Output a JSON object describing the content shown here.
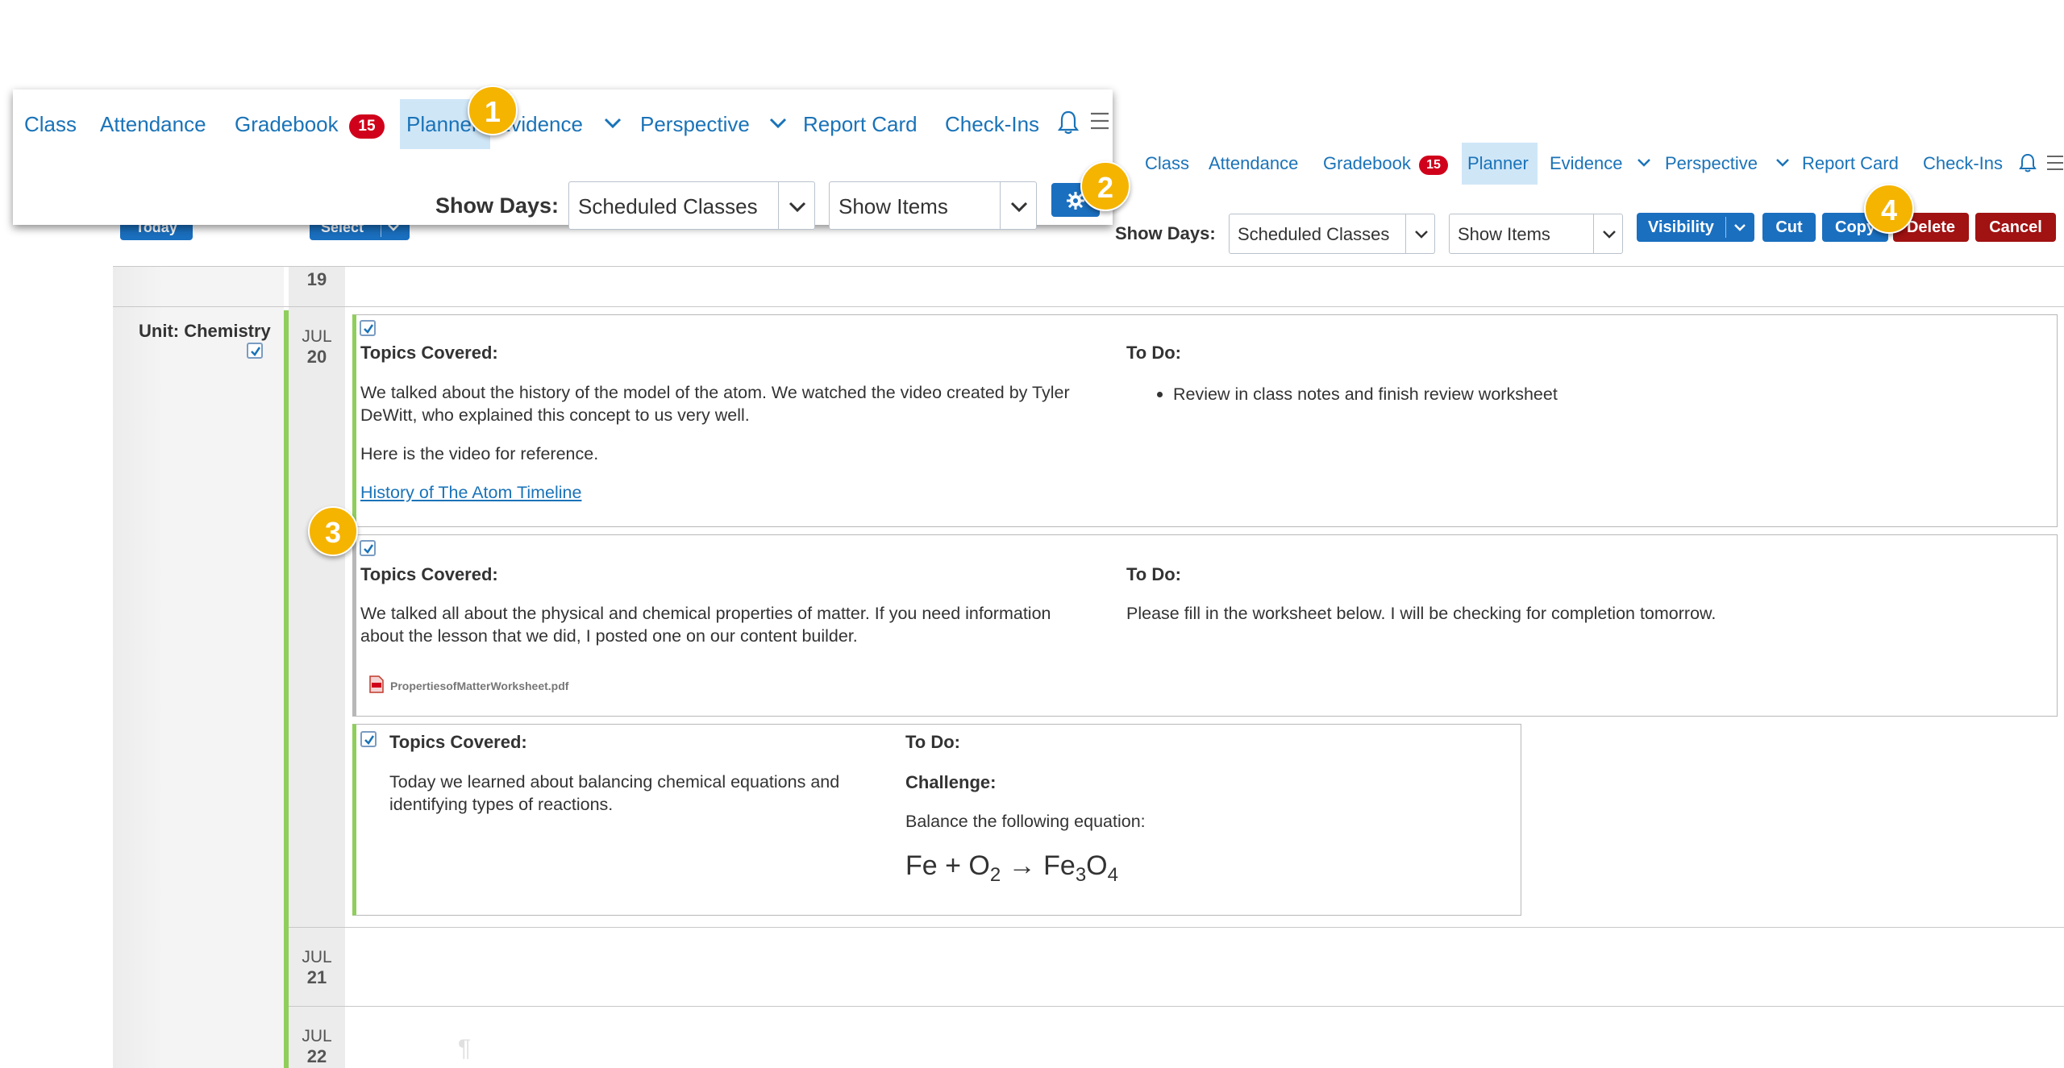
{
  "nav_zoom": {
    "items": [
      {
        "label": "Class"
      },
      {
        "label": "Attendance"
      },
      {
        "label": "Gradebook",
        "badge": "15"
      },
      {
        "label": "Planner",
        "active": true
      },
      {
        "label": "Evidence",
        "dropdown": true
      },
      {
        "label": "Perspective",
        "dropdown": true
      },
      {
        "label": "Report Card"
      },
      {
        "label": "Check-Ins"
      }
    ],
    "show_days_label": "Show Days:",
    "days_select_value": "Scheduled Classes",
    "items_select_value": "Show Items",
    "bell_icon": "bell-icon",
    "menu_icon": "hamburger-icon",
    "gear_icon": "gear-icon"
  },
  "nav_main": {
    "items": [
      {
        "label": "Class"
      },
      {
        "label": "Attendance"
      },
      {
        "label": "Gradebook",
        "badge": "15"
      },
      {
        "label": "Planner",
        "active": true
      },
      {
        "label": "Evidence",
        "dropdown": true
      },
      {
        "label": "Perspective",
        "dropdown": true
      },
      {
        "label": "Report Card"
      },
      {
        "label": "Check-Ins"
      }
    ],
    "show_days_label": "Show Days:",
    "days_select_value": "Scheduled Classes",
    "items_select_value": "Show Items"
  },
  "toolbar": {
    "today_label": "Today",
    "select_label": "Select",
    "visibility_label": "Visibility",
    "cut_label": "Cut",
    "copy_label": "Copy",
    "delete_label": "Delete",
    "cancel_label": "Cancel"
  },
  "callouts": [
    "1",
    "2",
    "3",
    "4"
  ],
  "planner": {
    "unit_label": "Unit: Chemistry",
    "day19": {
      "day": "19"
    },
    "day20": {
      "month": "JUL",
      "day": "20"
    },
    "day21": {
      "month": "JUL",
      "day": "21"
    },
    "day22": {
      "month": "JUL",
      "day": "22"
    },
    "cards": [
      {
        "topics_heading": "Topics Covered:",
        "topics_text": "We talked about the history of the model of the atom. We watched the video created by Tyler DeWitt, who explained this concept to us very well.",
        "topics_text2": "Here is the video for reference.",
        "link_text": "History of The Atom Timeline",
        "todo_heading": "To Do:",
        "todo_bullet": "Review in class notes and finish review worksheet"
      },
      {
        "topics_heading": "Topics Covered:",
        "topics_text": "We talked all about the physical and chemical properties of matter. If you need information about the lesson that we did, I posted one on our content builder.",
        "attachment_name": "PropertiesofMatterWorksheet.pdf",
        "todo_heading": "To Do:",
        "todo_text": "Please fill in the worksheet below. I will be checking for completion tomorrow."
      },
      {
        "topics_heading": "Topics Covered:",
        "topics_text": "Today we learned about balancing chemical equations and identifying types of reactions.",
        "todo_heading": "To Do:",
        "challenge_heading": "Challenge:",
        "challenge_text": "Balance the following equation:",
        "equation": {
          "a": "Fe + O",
          "a_sub": "2",
          "arrow": " → Fe",
          "b_sub": "3",
          "c": "O",
          "c_sub": "4"
        }
      }
    ],
    "pilcrow": "¶"
  },
  "colors": {
    "link_blue": "#1a73b8",
    "button_blue": "#1a6fbf",
    "button_red": "#a11212",
    "badge_red": "#d0021b",
    "active_tab_bg": "#cfe6f7",
    "unit_green": "#8fce5b",
    "callout_yellow": "#f5b400"
  }
}
